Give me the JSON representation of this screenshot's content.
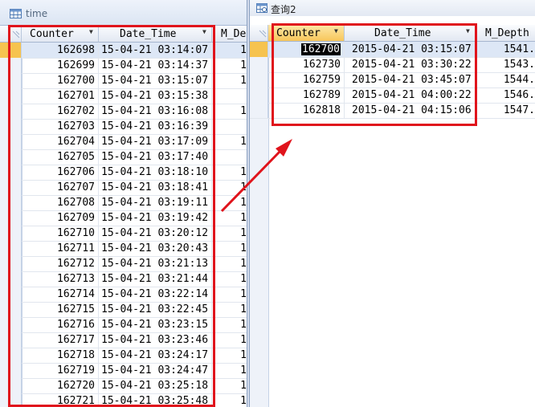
{
  "left_window": {
    "title": "time",
    "icon": "table-icon",
    "columns": [
      "Counter",
      "Date_Time",
      "M_De"
    ],
    "rows": [
      {
        "counter": "162698",
        "date_time": "15-04-21  03:14:07",
        "m": "1"
      },
      {
        "counter": "162699",
        "date_time": "15-04-21  03:14:37",
        "m": "1"
      },
      {
        "counter": "162700",
        "date_time": "15-04-21  03:15:07",
        "m": "1"
      },
      {
        "counter": "162701",
        "date_time": "15-04-21  03:15:38",
        "m": ""
      },
      {
        "counter": "162702",
        "date_time": "15-04-21  03:16:08",
        "m": "1"
      },
      {
        "counter": "162703",
        "date_time": "15-04-21  03:16:39",
        "m": ""
      },
      {
        "counter": "162704",
        "date_time": "15-04-21  03:17:09",
        "m": "1"
      },
      {
        "counter": "162705",
        "date_time": "15-04-21  03:17:40",
        "m": ""
      },
      {
        "counter": "162706",
        "date_time": "15-04-21  03:18:10",
        "m": "1"
      },
      {
        "counter": "162707",
        "date_time": "15-04-21  03:18:41",
        "m": "1"
      },
      {
        "counter": "162708",
        "date_time": "15-04-21  03:19:11",
        "m": "1"
      },
      {
        "counter": "162709",
        "date_time": "15-04-21  03:19:42",
        "m": "1"
      },
      {
        "counter": "162710",
        "date_time": "15-04-21  03:20:12",
        "m": "1"
      },
      {
        "counter": "162711",
        "date_time": "15-04-21  03:20:43",
        "m": "1"
      },
      {
        "counter": "162712",
        "date_time": "15-04-21  03:21:13",
        "m": "1"
      },
      {
        "counter": "162713",
        "date_time": "15-04-21  03:21:44",
        "m": "1"
      },
      {
        "counter": "162714",
        "date_time": "15-04-21  03:22:14",
        "m": "1"
      },
      {
        "counter": "162715",
        "date_time": "15-04-21  03:22:45",
        "m": "1"
      },
      {
        "counter": "162716",
        "date_time": "15-04-21  03:23:15",
        "m": "1"
      },
      {
        "counter": "162717",
        "date_time": "15-04-21  03:23:46",
        "m": "1"
      },
      {
        "counter": "162718",
        "date_time": "15-04-21  03:24:17",
        "m": "1"
      },
      {
        "counter": "162719",
        "date_time": "15-04-21  03:24:47",
        "m": "1"
      },
      {
        "counter": "162720",
        "date_time": "15-04-21  03:25:18",
        "m": "1"
      },
      {
        "counter": "162721",
        "date_time": "15-04-21  03:25:48",
        "m": "1"
      }
    ]
  },
  "right_window": {
    "title": "查询2",
    "icon": "query-icon",
    "columns": [
      "Counter",
      "Date_Time",
      "M_Depth"
    ],
    "rows": [
      {
        "counter": "162700",
        "date_time": "2015-04-21  03:15:07",
        "m_depth": "1541."
      },
      {
        "counter": "162730",
        "date_time": "2015-04-21  03:30:22",
        "m_depth": "1543."
      },
      {
        "counter": "162759",
        "date_time": "2015-04-21  03:45:07",
        "m_depth": "1544."
      },
      {
        "counter": "162789",
        "date_time": "2015-04-21  04:00:22",
        "m_depth": "1546."
      },
      {
        "counter": "162818",
        "date_time": "2015-04-21  04:15:06",
        "m_depth": "1547."
      }
    ]
  },
  "annotation": {
    "color": "#e0141c"
  }
}
